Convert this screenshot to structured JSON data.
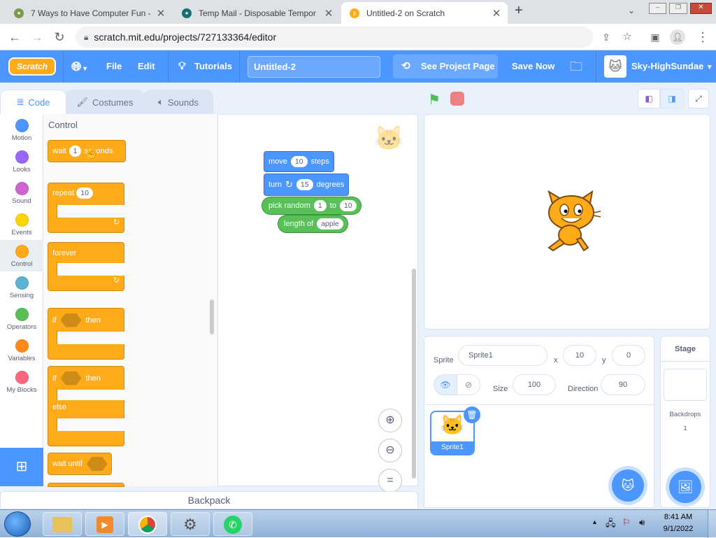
{
  "browser": {
    "tabs": [
      {
        "title": "7 Ways to Have Computer Fun -",
        "active": false
      },
      {
        "title": "Temp Mail - Disposable Tempor",
        "active": false
      },
      {
        "title": "Untitled-2 on Scratch",
        "active": true
      }
    ],
    "new_tab": "+",
    "url": "scratch.mit.edu/projects/727133364/editor"
  },
  "menu": {
    "logo": "Scratch",
    "file": "File",
    "edit": "Edit",
    "tutorials": "Tutorials",
    "project_title": "Untitled-2",
    "see_project": "See Project Page",
    "save_now": "Save Now",
    "username": "Sky-HighSundae"
  },
  "editor_tabs": {
    "code": "Code",
    "costumes": "Costumes",
    "sounds": "Sounds"
  },
  "categories": [
    {
      "label": "Motion",
      "color": "#4c97ff"
    },
    {
      "label": "Looks",
      "color": "#9966ff"
    },
    {
      "label": "Sound",
      "color": "#cf63cf"
    },
    {
      "label": "Events",
      "color": "#ffd500"
    },
    {
      "label": "Control",
      "color": "#ffab19"
    },
    {
      "label": "Sensing",
      "color": "#5cb1d6"
    },
    {
      "label": "Operators",
      "color": "#59c059"
    },
    {
      "label": "Variables",
      "color": "#ff8c1a"
    },
    {
      "label": "My Blocks",
      "color": "#ff6680"
    }
  ],
  "palette": {
    "heading": "Control",
    "wait": {
      "prefix": "wait",
      "value": "1",
      "suffix": "seconds"
    },
    "repeat": {
      "label": "repeat",
      "value": "10"
    },
    "forever": "forever",
    "if_then": {
      "if": "if",
      "then": "then"
    },
    "if_else": {
      "if": "if",
      "then": "then",
      "else": "else"
    },
    "wait_until": "wait until"
  },
  "script": {
    "move": {
      "prefix": "move",
      "value": "10",
      "suffix": "steps"
    },
    "turn": {
      "prefix": "turn",
      "value": "15",
      "suffix": "degrees"
    },
    "pick_random": {
      "prefix": "pick random",
      "from": "1",
      "mid": "to",
      "to": "10"
    },
    "length_of": {
      "prefix": "length of",
      "value": "apple"
    }
  },
  "zoom": {
    "in": "⊕",
    "out": "⊖",
    "reset": "="
  },
  "backpack": "Backpack",
  "sprite_info": {
    "sprite_label": "Sprite",
    "sprite_name": "Sprite1",
    "x_label": "x",
    "x": "10",
    "y_label": "y",
    "y": "0",
    "size_label": "Size",
    "size": "100",
    "direction_label": "Direction",
    "direction": "90"
  },
  "sprite_tile": "Sprite1",
  "stage_panel": {
    "title": "Stage",
    "backdrops_label": "Backdrops",
    "backdrops_count": "1"
  },
  "taskbar": {
    "time": "8:41 AM",
    "date": "9/1/2022"
  }
}
